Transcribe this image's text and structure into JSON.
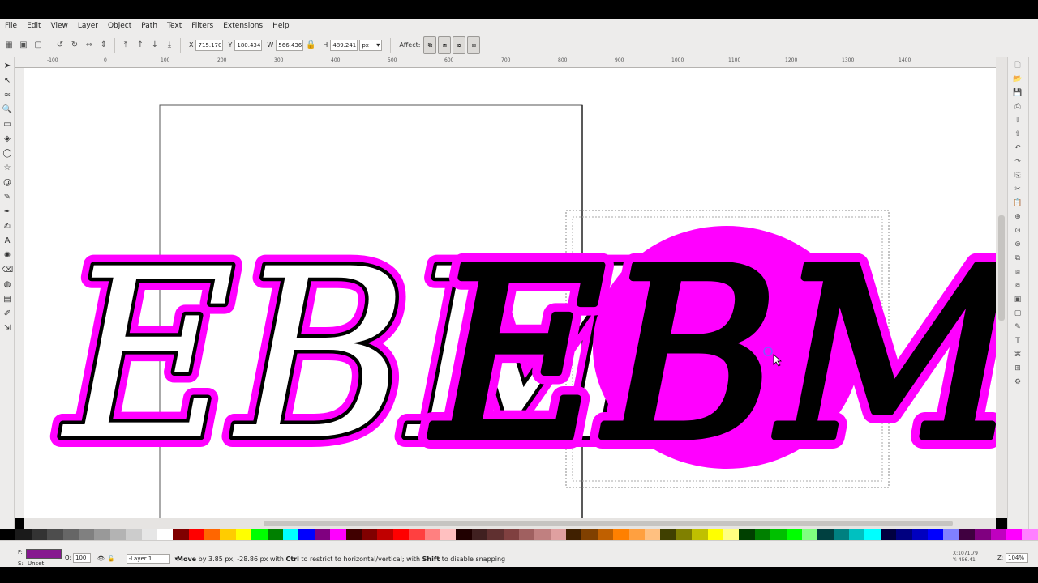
{
  "menu": [
    "File",
    "Edit",
    "View",
    "Layer",
    "Object",
    "Path",
    "Text",
    "Filters",
    "Extensions",
    "Help"
  ],
  "toolbar": {
    "x_label": "X",
    "x_value": "715.170",
    "y_label": "Y",
    "y_value": "180.434",
    "w_label": "W",
    "w_value": "566.436",
    "h_label": "H",
    "h_value": "489.241",
    "unit": "px",
    "affect_label": "Affect:"
  },
  "ruler_top": [
    "-100",
    "0",
    "100",
    "200",
    "300",
    "400",
    "500",
    "600",
    "700",
    "800",
    "900",
    "1000",
    "1100",
    "1200",
    "1300",
    "1400"
  ],
  "canvas": {
    "monogram_left_text": "EBM",
    "monogram_right_text": "EBM"
  },
  "status": {
    "fill_label": "F:",
    "stroke_label": "S:",
    "stroke_value": "Unset",
    "opacity_label": "O:",
    "opacity_value": "100",
    "layer_name": "-Layer 1",
    "message_bold1": "Move",
    "message_part1": " by 3.85 px, -28.86 px with ",
    "message_bold2": "Ctrl",
    "message_part2": " to restrict to horizontal/vertical; with ",
    "message_bold3": "Shift",
    "message_part3": " to disable snapping",
    "coords_x": "X:1071.79",
    "coords_y": "Y: 456.41",
    "zoom_label": "Z:",
    "zoom_value": "104%"
  },
  "colors": {
    "magenta": "#ff00ff",
    "fill_swatch": "#86188f",
    "ui_bg": "#edeceb"
  },
  "palette": [
    "#000000",
    "#1a1a1a",
    "#333333",
    "#4d4d4d",
    "#666666",
    "#808080",
    "#999999",
    "#b3b3b3",
    "#cccccc",
    "#e6e6e6",
    "#ffffff",
    "#800000",
    "#ff0000",
    "#ff6600",
    "#ffcc00",
    "#ffff00",
    "#00ff00",
    "#008000",
    "#00ffff",
    "#0000ff",
    "#800080",
    "#ff00ff",
    "#400000",
    "#800000",
    "#c00000",
    "#ff0000",
    "#ff4040",
    "#ff8080",
    "#ffc0c0",
    "#200000",
    "#402020",
    "#603030",
    "#804040",
    "#a06060",
    "#c08080",
    "#e0a0a0",
    "#402000",
    "#804000",
    "#c06000",
    "#ff8000",
    "#ffa040",
    "#ffc080",
    "#404000",
    "#808000",
    "#c0c000",
    "#ffff00",
    "#ffff80",
    "#004000",
    "#008000",
    "#00c000",
    "#00ff00",
    "#80ff80",
    "#004040",
    "#008080",
    "#00c0c0",
    "#00ffff",
    "#000040",
    "#000080",
    "#0000c0",
    "#0000ff",
    "#8080ff",
    "#400040",
    "#800080",
    "#c000c0",
    "#ff00ff",
    "#ff80ff"
  ]
}
